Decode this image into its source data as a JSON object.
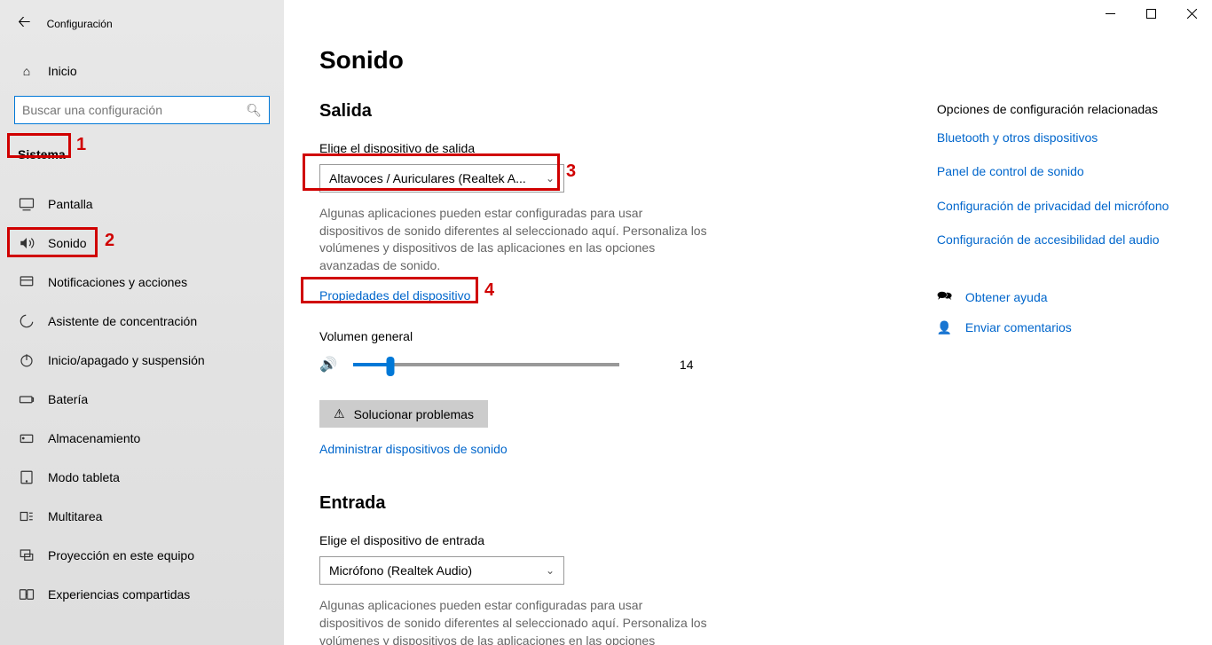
{
  "app_title": "Configuración",
  "home_label": "Inicio",
  "search_placeholder": "Buscar una configuración",
  "category": "Sistema",
  "nav": [
    {
      "label": "Pantalla"
    },
    {
      "label": "Sonido"
    },
    {
      "label": "Notificaciones y acciones"
    },
    {
      "label": "Asistente de concentración"
    },
    {
      "label": "Inicio/apagado y suspensión"
    },
    {
      "label": "Batería"
    },
    {
      "label": "Almacenamiento"
    },
    {
      "label": "Modo tableta"
    },
    {
      "label": "Multitarea"
    },
    {
      "label": "Proyección en este equipo"
    },
    {
      "label": "Experiencias compartidas"
    }
  ],
  "page_title": "Sonido",
  "output": {
    "section": "Salida",
    "choose_label": "Elige el dispositivo de salida",
    "device": "Altavoces / Auriculares (Realtek A...",
    "desc": "Algunas aplicaciones pueden estar configuradas para usar dispositivos de sonido diferentes al seleccionado aquí. Personaliza los volúmenes y dispositivos de las aplicaciones en las opciones avanzadas de sonido.",
    "properties": "Propiedades del dispositivo",
    "volume_label": "Volumen general",
    "volume_value": "14",
    "troubleshoot": "Solucionar problemas",
    "manage": "Administrar dispositivos de sonido"
  },
  "input": {
    "section": "Entrada",
    "choose_label": "Elige el dispositivo de entrada",
    "device": "Micrófono (Realtek Audio)",
    "desc": "Algunas aplicaciones pueden estar configuradas para usar dispositivos de sonido diferentes al seleccionado aquí. Personaliza los volúmenes y dispositivos de las aplicaciones en las opciones"
  },
  "related": {
    "title": "Opciones de configuración relacionadas",
    "links": [
      "Bluetooth y otros dispositivos",
      "Panel de control de sonido",
      "Configuración de privacidad del micrófono",
      "Configuración de accesibilidad del audio"
    ],
    "help": "Obtener ayuda",
    "feedback": "Enviar comentarios"
  },
  "annotations": {
    "n1": "1",
    "n2": "2",
    "n3": "3",
    "n4": "4"
  }
}
